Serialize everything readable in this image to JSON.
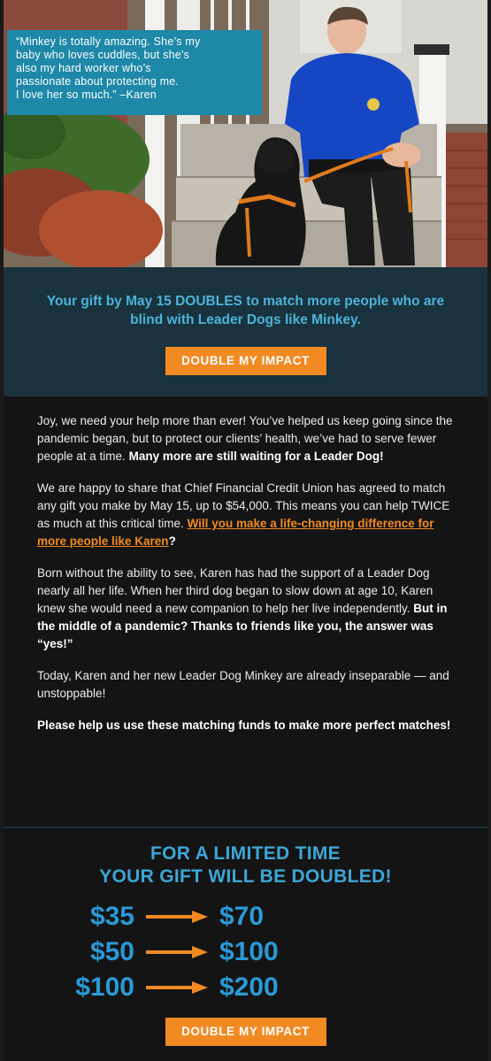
{
  "quote": {
    "line1": "“Minkey is totally amazing. She’s my",
    "line2": "baby who loves cuddles, but she’s",
    "line3": "also my hard worker who’s",
    "line4": "passionate about protecting me.",
    "line5": "I love her so much.” –Karen"
  },
  "banner": {
    "text": "Your gift by May 15 DOUBLES to match more people who are blind with Leader Dogs like Minkey.",
    "button": "DOUBLE MY IMPACT"
  },
  "body": {
    "p1": "Joy, we need your help more than ever! You’ve helped us keep going since the pandemic began, but to protect our clients’ health, we’ve had to serve fewer people at a time. ",
    "p1_bold": "Many more are still waiting for a Leader Dog!",
    "p2": "We are happy to share that Chief Financial Credit Union has agreed to match any gift you make by May 15, up to $54,000. This means you can help TWICE as much at this critical time. ",
    "p2_link": "Will you make a life-changing difference for more people like Karen",
    "p2_end": "?",
    "p3": "Born without the ability to see, Karen has had the support of a Leader Dog nearly all her life. When her third dog began to slow down at age 10, Karen knew she would need a new companion to help her live independently. ",
    "p3_bold": "But in the middle of a pandemic? Thanks to friends like you, the answer was “yes!”",
    "p4": "Today, Karen and her new Leader Dog Minkey are already inseparable — and unstoppable!",
    "p5": "Please help us use these matching funds to make more perfect matches!"
  },
  "limited": {
    "line1": "FOR A LIMITED TIME",
    "line2": "YOUR GIFT WILL BE DOUBLED!",
    "rows": [
      {
        "from": "$35",
        "to": "$70"
      },
      {
        "from": "$50",
        "to": "$100"
      },
      {
        "from": "$100",
        "to": "$200"
      }
    ],
    "button": "DOUBLE MY IMPACT"
  },
  "colors": {
    "accent_orange": "#f18a23",
    "teal_text": "#4cb3d9",
    "banner_bg": "#19323d",
    "quote_bg": "#1e88a8"
  }
}
